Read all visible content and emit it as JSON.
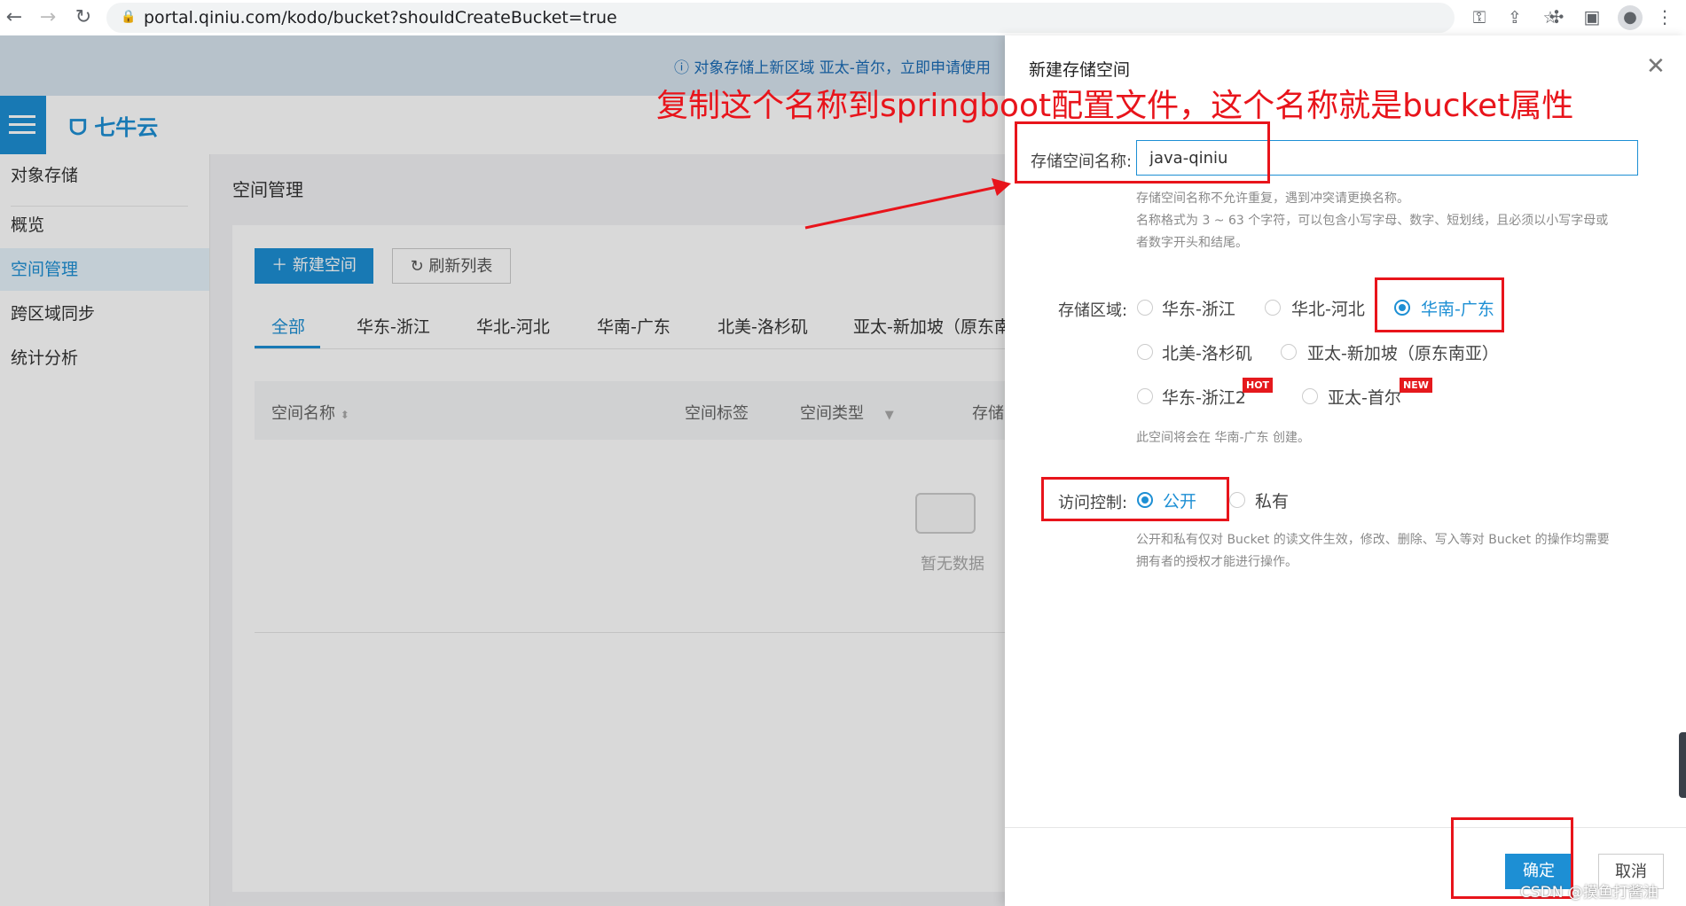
{
  "browser": {
    "url": "portal.qiniu.com/kodo/bucket?shouldCreateBucket=true"
  },
  "banner": {
    "text": "对象存储上新区域 亚太-首尔，立即申请使用"
  },
  "logo": {
    "text": "七牛云"
  },
  "sidebar": {
    "section_title": "对象存储",
    "items": [
      {
        "label": "概览"
      },
      {
        "label": "空间管理"
      },
      {
        "label": "跨区域同步"
      },
      {
        "label": "统计分析"
      }
    ],
    "active_index": 1
  },
  "main": {
    "page_title": "空间管理",
    "new_button": "新建空间",
    "refresh_button": "刷新列表",
    "tabs": [
      {
        "label": "全部"
      },
      {
        "label": "华东-浙江"
      },
      {
        "label": "华北-河北"
      },
      {
        "label": "华南-广东"
      },
      {
        "label": "北美-洛杉矶"
      },
      {
        "label": "亚太-新加坡（原东南亚）"
      }
    ],
    "active_tab": 0,
    "columns": [
      {
        "label": "空间名称"
      },
      {
        "label": "空间标签"
      },
      {
        "label": "空间类型"
      },
      {
        "label": "存储"
      }
    ],
    "empty_text": "暂无数据"
  },
  "drawer": {
    "title": "新建存储空间",
    "name_label": "存储空间名称:",
    "name_value": "java-qiniu",
    "name_hints": [
      "存储空间名称不允许重复，遇到冲突请更换名称。",
      "名称格式为 3 ~ 63 个字符，可以包含小写字母、数字、短划线，且必须以小写字母或",
      "者数字开头和结尾。"
    ],
    "region_label": "存储区域:",
    "regions": [
      {
        "label": "华东-浙江",
        "selected": false
      },
      {
        "label": "华北-河北",
        "selected": false
      },
      {
        "label": "华南-广东",
        "selected": true
      },
      {
        "label": "北美-洛杉矶",
        "selected": false
      },
      {
        "label": "亚太-新加坡（原东南亚）",
        "selected": false
      },
      {
        "label": "华东-浙江2",
        "selected": false,
        "badge": "HOT"
      },
      {
        "label": "亚太-首尔",
        "selected": false,
        "badge": "NEW"
      }
    ],
    "region_hint": "此空间将会在 华南-广东 创建。",
    "access_label": "访问控制:",
    "access_options": [
      {
        "label": "公开",
        "selected": true
      },
      {
        "label": "私有",
        "selected": false
      }
    ],
    "access_hints": [
      "公开和私有仅对 Bucket 的读文件生效，修改、删除、写入等对 Bucket 的操作均需要",
      "拥有者的授权才能进行操作。"
    ],
    "ok_button": "确定",
    "cancel_button": "取消"
  },
  "annotation": {
    "text": "复制这个名称到springboot配置文件，这个名称就是bucket属性",
    "color": "#e8141b"
  },
  "watermark": "CSDN @摸鱼打酱油",
  "colors": {
    "accent": "#1d8fd4",
    "annotation_red": "#e8141b",
    "badge_red": "#e5191d"
  }
}
